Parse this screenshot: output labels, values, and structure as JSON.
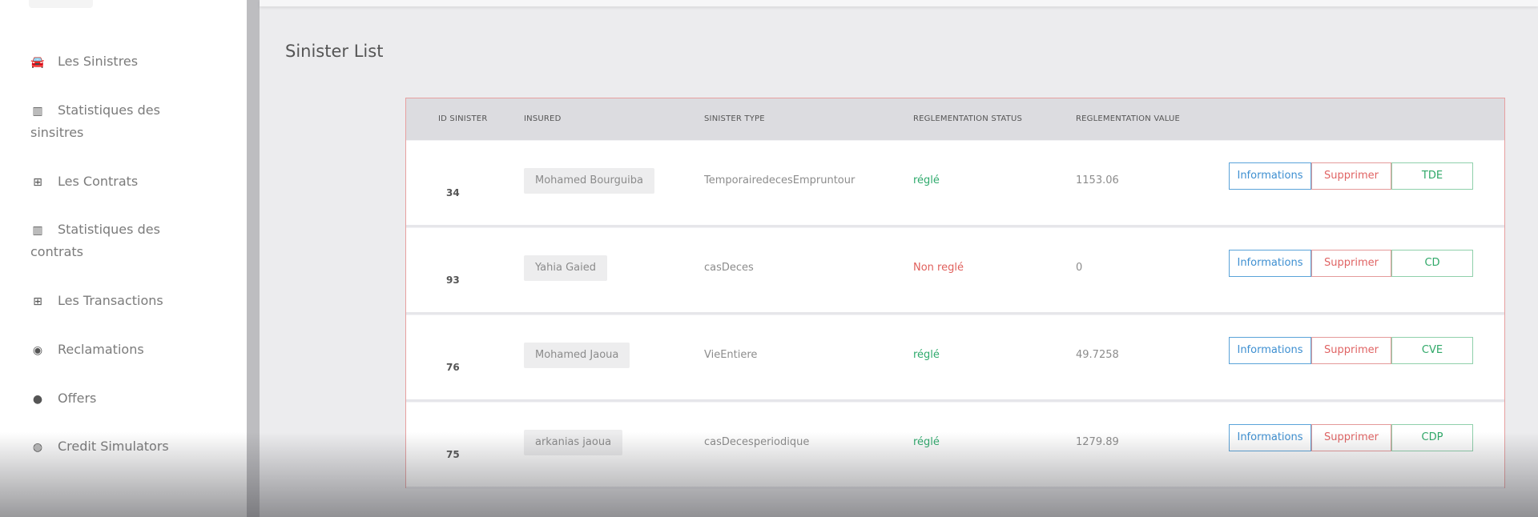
{
  "sidebar": {
    "items": [
      {
        "icon": "tachometer-icon",
        "glyph": "🚘",
        "label": "Les Sinistres"
      },
      {
        "icon": "bar-chart-icon",
        "glyph": "▥",
        "label_line1": "Statistiques des",
        "label_line2": "sinsitres"
      },
      {
        "icon": "table-icon",
        "glyph": "⊞",
        "label": "Les Contrats"
      },
      {
        "icon": "bar-chart-icon",
        "glyph": "▥",
        "label_line1": "Statistiques des",
        "label_line2": "contrats"
      },
      {
        "icon": "table-icon",
        "glyph": "⊞",
        "label": "Les Transactions"
      },
      {
        "icon": "eye-icon",
        "glyph": "◉",
        "label": "Reclamations"
      },
      {
        "icon": "gift-icon",
        "glyph": "●",
        "label": "Offers"
      },
      {
        "icon": "globe-icon",
        "glyph": "◍",
        "label": "Credit Simulators"
      }
    ]
  },
  "main": {
    "title": "Sinister List",
    "table": {
      "headers": [
        "ID SINISTER",
        "INSURED",
        "SINISTER TYPE",
        "REGLEMENTATION STATUS",
        "REGLEMENTATION VALUE"
      ],
      "rows": [
        {
          "id": "34",
          "insured": "Mohamed Bourguiba",
          "type": "TemporairedecesEmpruntour",
          "status": "réglé",
          "status_kind": "ok",
          "value": "1153.06",
          "code": "TDE"
        },
        {
          "id": "93",
          "insured": "Yahia Gaied",
          "type": "casDeces",
          "status": "Non reglé",
          "status_kind": "nok",
          "value": "0",
          "code": "CD"
        },
        {
          "id": "76",
          "insured": "Mohamed Jaoua",
          "type": "VieEntiere",
          "status": "réglé",
          "status_kind": "ok",
          "value": "49.7258",
          "code": "CVE"
        },
        {
          "id": "75",
          "insured": "arkanias jaoua",
          "type": "casDecesperiodique",
          "status": "réglé",
          "status_kind": "ok",
          "value": "1279.89",
          "code": "CDP"
        }
      ],
      "action_info": "Informations",
      "action_delete": "Supprimer"
    }
  },
  "colors": {
    "accent_blue": "#3d8fd1",
    "danger_red": "#e06464",
    "success_green": "#2fa868",
    "table_border": "#e7a0a0"
  }
}
